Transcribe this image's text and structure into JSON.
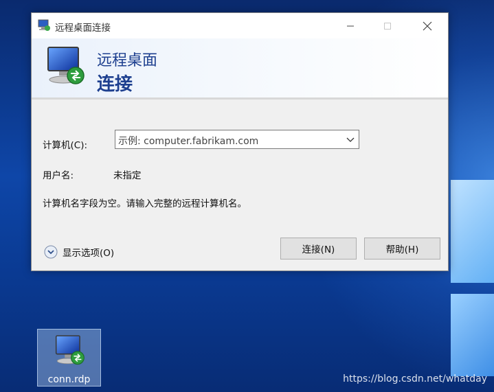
{
  "window": {
    "title": "远程桌面连接",
    "min_icon": "minimize-icon",
    "max_icon": "maximize-icon",
    "close_icon": "close-icon"
  },
  "banner": {
    "line1": "远程桌面",
    "line2": "连接",
    "icon": "remote-desktop-icon"
  },
  "form": {
    "computer_label": "计算机(C):",
    "computer_placeholder": "示例: computer.fabrikam.com",
    "user_label": "用户名:",
    "user_value": "未指定",
    "message": "计算机名字段为空。请输入完整的远程计算机名。"
  },
  "footer": {
    "show_options": "显示选项(O)",
    "connect": "连接(N)",
    "help": "帮助(H)"
  },
  "desktop": {
    "file_label": "conn.rdp",
    "watermark": "https://blog.csdn.net/whatday"
  },
  "colors": {
    "accent": "#1d3f8f",
    "desktop": "#0e46a8"
  }
}
